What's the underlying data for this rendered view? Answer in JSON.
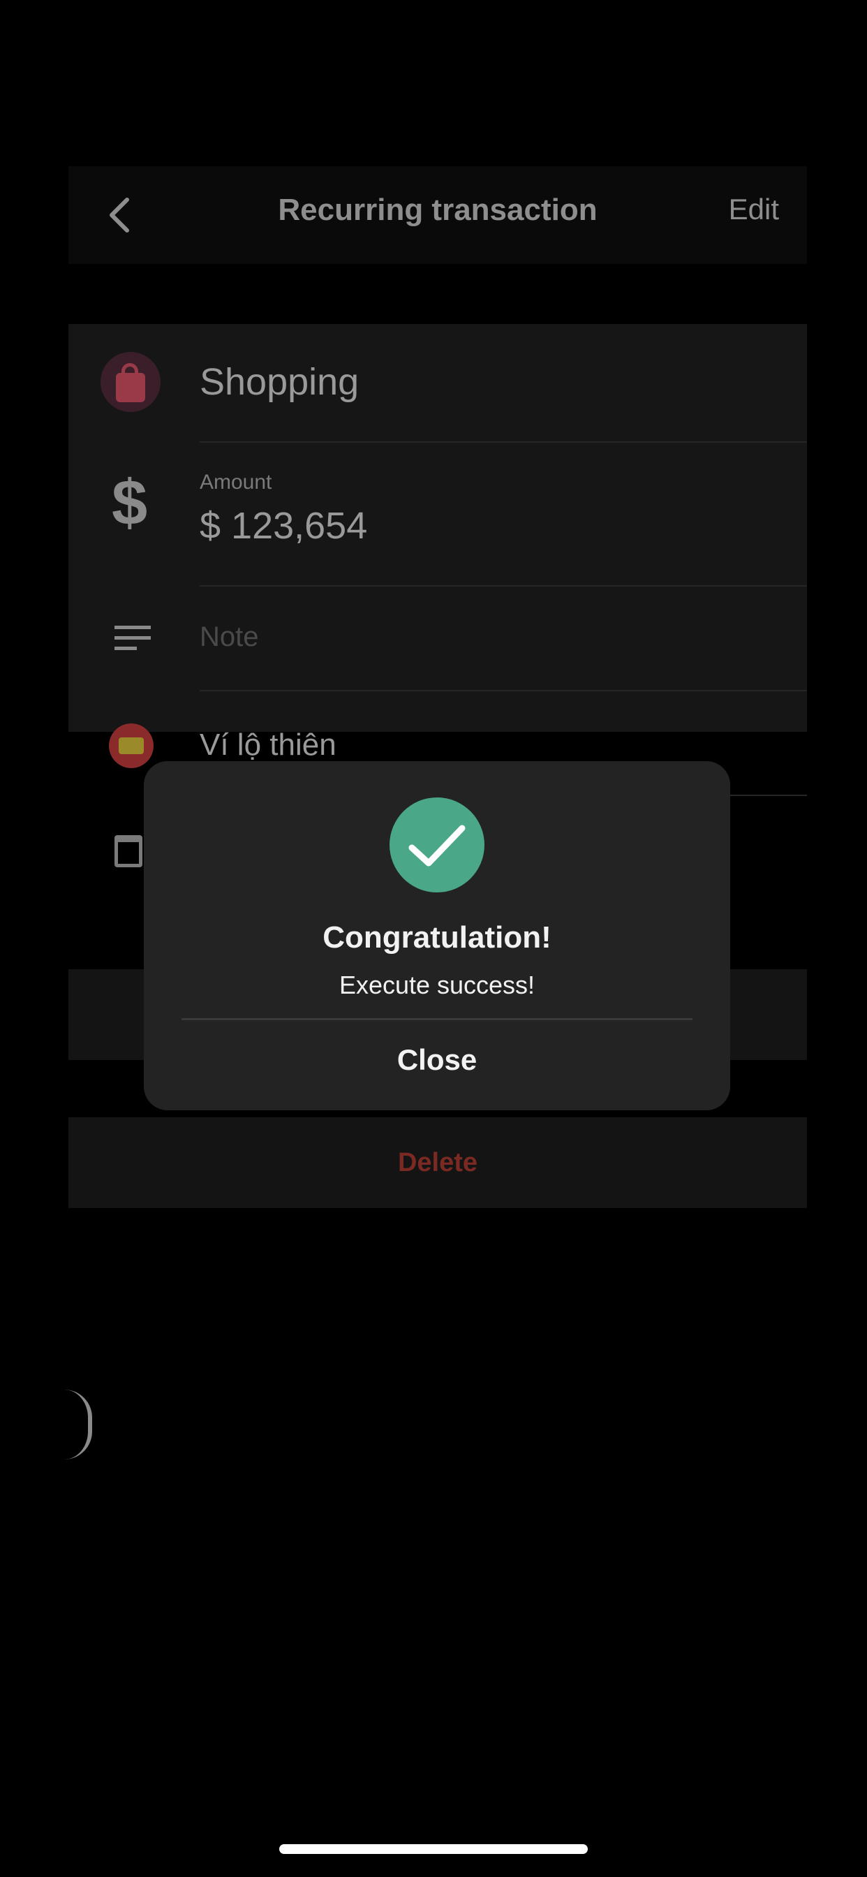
{
  "navbar": {
    "title": "Recurring transaction",
    "edit_label": "Edit",
    "back_icon": "chevron-left-icon"
  },
  "details": {
    "category": {
      "name": "Shopping",
      "icon": "shopping-bag-icon"
    },
    "amount": {
      "label": "Amount",
      "value": "$ 123,654",
      "icon": "dollar-icon"
    },
    "note": {
      "placeholder": "Note",
      "icon": "note-lines-icon"
    },
    "wallet": {
      "name": "Ví lộ thiên",
      "icon": "wallet-icon"
    },
    "date": {
      "icon": "calendar-icon"
    }
  },
  "actions": {
    "delete_label": "Delete"
  },
  "dialog": {
    "icon": "checkmark-icon",
    "title": "Congratulation!",
    "message": "Execute success!",
    "close_label": "Close"
  },
  "colors": {
    "success": "#4aa889",
    "delete": "#7a2a22",
    "dialog_bg": "#232323"
  }
}
